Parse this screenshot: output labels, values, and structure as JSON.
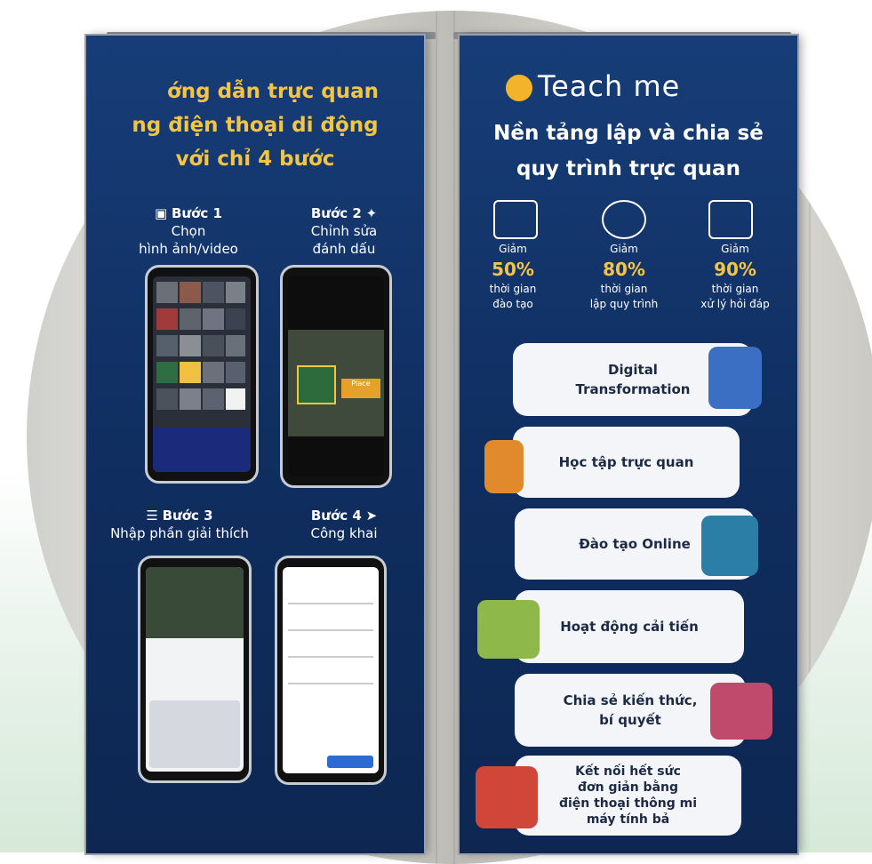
{
  "left_banner": {
    "headline": [
      "ớng dẫn trực quan",
      "ng điện thoại di động",
      "với chỉ 4 bước"
    ],
    "steps": [
      {
        "num": "Bước 1",
        "text1": "Chọn",
        "text2": "hình ảnh/video",
        "icon": "image-icon"
      },
      {
        "num": "Bước 2",
        "text1": "Chỉnh sửa",
        "text2": "đánh dấu",
        "icon": "magic-wand-icon"
      },
      {
        "num": "Bước 3",
        "text1": "Nhập phần giải thích",
        "text2": "",
        "icon": "list-icon"
      },
      {
        "num": "Bước 4",
        "text1": "Công khai",
        "text2": "",
        "icon": "send-icon"
      }
    ]
  },
  "right_banner": {
    "logo": "Teach me",
    "tagline": [
      "Nền tảng lập và chia sẻ",
      "quy trình trực quan"
    ],
    "stats": [
      {
        "label": "Giảm",
        "pct": "50%",
        "desc1": "thời gian",
        "desc2": "đào tạo",
        "icon": "course-icon"
      },
      {
        "label": "Giảm",
        "pct": "80%",
        "desc1": "thời gian",
        "desc2": "lập quy trình",
        "icon": "speed-icon"
      },
      {
        "label": "Giảm",
        "pct": "90%",
        "desc1": "thời gian",
        "desc2": "xử lý hỏi đáp",
        "icon": "faq-icon"
      }
    ],
    "features": [
      {
        "text": "Digital\nTransformation"
      },
      {
        "text": "Học tập trực quan"
      },
      {
        "text": "Đào tạo Online"
      },
      {
        "text": "Hoạt động cải tiến"
      },
      {
        "text": "Chia sẻ kiến thức,\nbí quyết"
      },
      {
        "text": "Kết nối hết sức\nđơn giản bằng\nđiện thoại thông mi\nmáy tính bả"
      }
    ]
  },
  "colors": {
    "banner": "#173d78",
    "accent": "#f4c542",
    "pill": "#f3f5f8"
  }
}
